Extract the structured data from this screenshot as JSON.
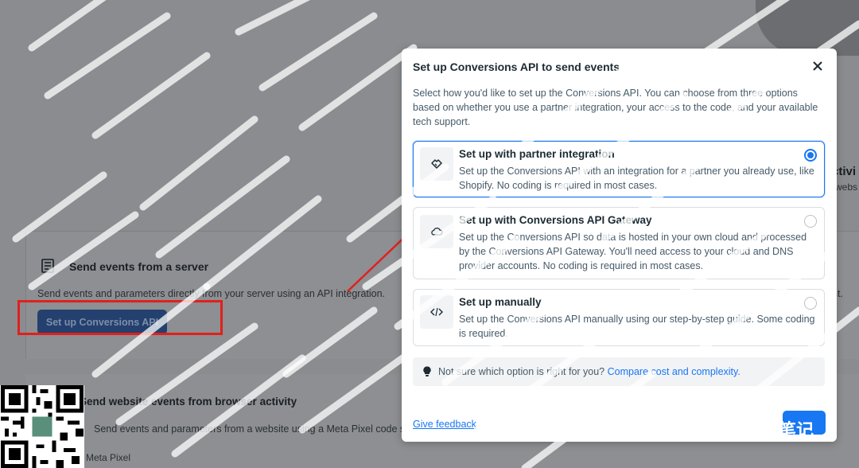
{
  "background": {
    "server_section": {
      "heading": "Send events from a server",
      "description": "Send events and parameters directly from your server using an API integration.",
      "description_tail": "nt.",
      "button_label": "Set up Conversions API"
    },
    "browser_section": {
      "heading": "Send website events from browser activity",
      "description": "Send events and parameters from a website using a Meta Pixel code snippet. This",
      "link": "Meta Pixel"
    },
    "right_fragment": {
      "heading": "ctivi",
      "sub": "webs"
    }
  },
  "modal": {
    "title": "Set up Conversions API to send events",
    "description": "Select how you'd like to set up the Conversions API. You can choose from three options based on whether you use a partner integration, your access to the code, and your available tech support.",
    "options": [
      {
        "title": "Set up with partner integration",
        "text": "Set up the Conversions API with an integration for a partner you already use, like Shopify. No coding is required in most cases.",
        "icon": "handshake-icon",
        "selected": true
      },
      {
        "title": "Set up with Conversions API Gateway",
        "text": "Set up the Conversions API so data is hosted in your own cloud and processed by the Conversions API Gateway. You'll need access to your cloud and DNS provider accounts. No coding is required in most cases.",
        "icon": "cloud-icon",
        "selected": false
      },
      {
        "title": "Set up manually",
        "text": "Set up the Conversions API manually using our step-by-step guide. Some coding is required.",
        "icon": "code-icon",
        "selected": false
      }
    ],
    "tip": {
      "text": "Not sure which option is right for you?",
      "link": "Compare cost and complexity."
    },
    "feedback_link": "Give feedback"
  },
  "watermark": {
    "text": "出海笔记"
  },
  "colors": {
    "accent": "#1877f2",
    "highlight": "#e0201d",
    "overlay": "#8a8c8f"
  }
}
